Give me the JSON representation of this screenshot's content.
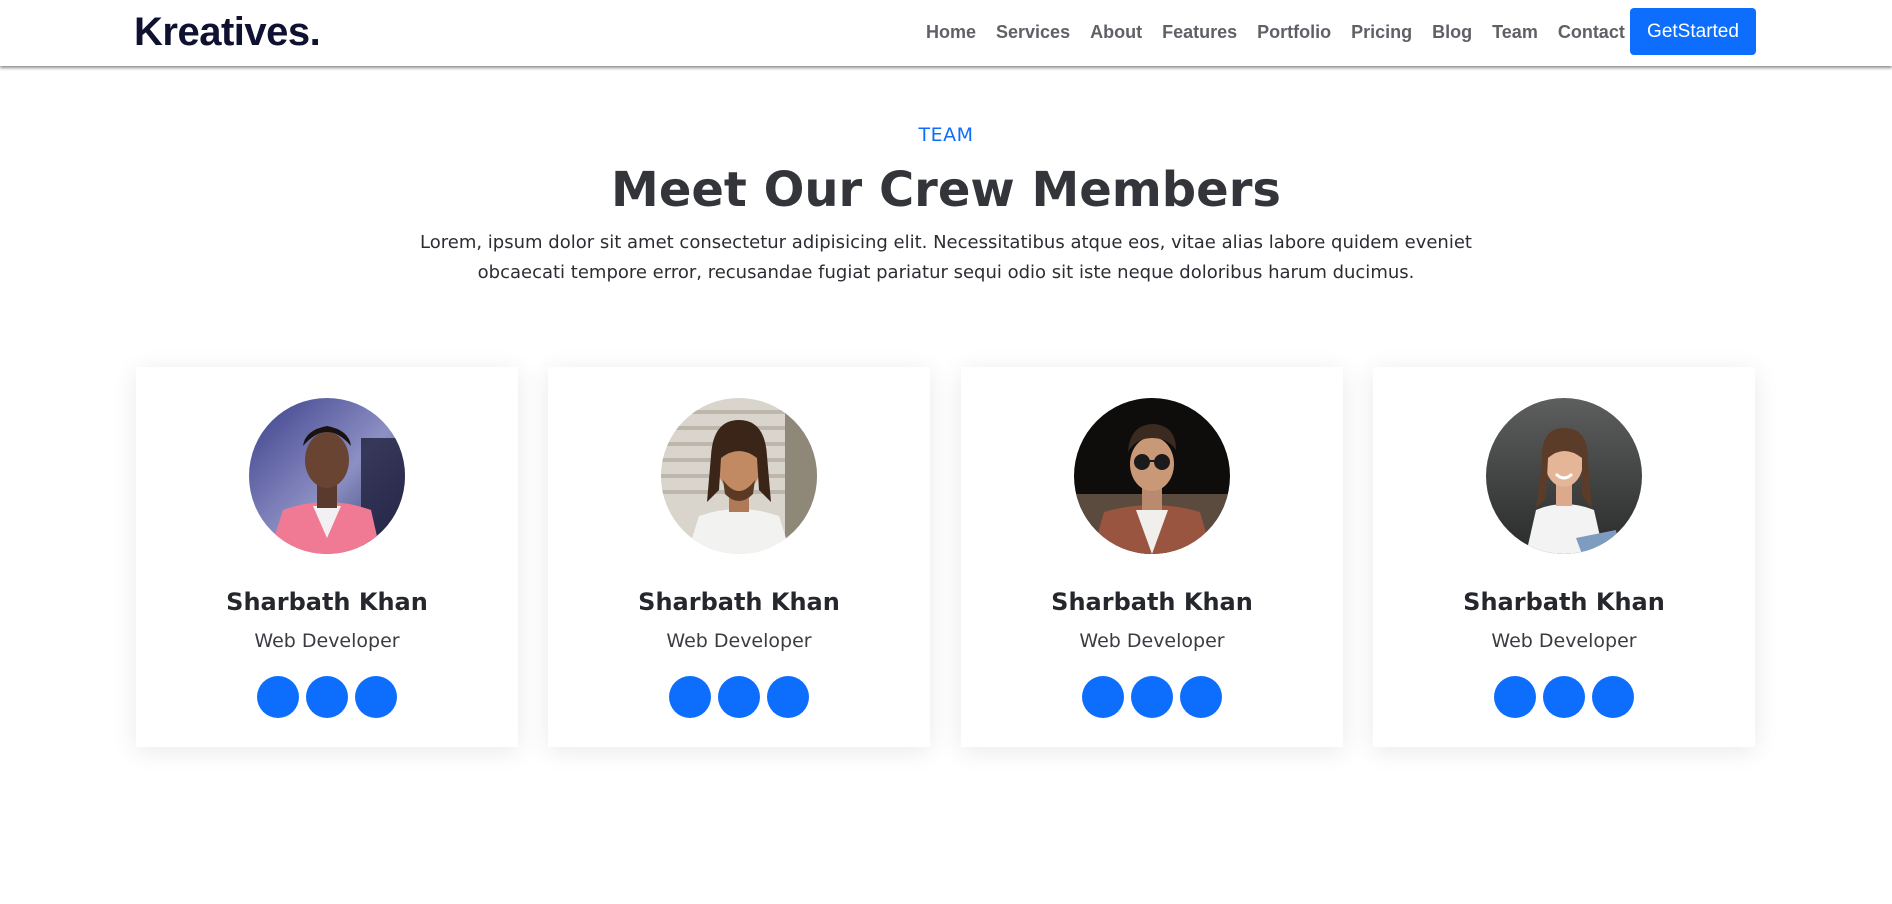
{
  "brand": {
    "logo": "Kreatives."
  },
  "nav": {
    "links": [
      "Home",
      "Services",
      "About",
      "Features",
      "Portfolio",
      "Pricing",
      "Blog",
      "Team",
      "Contact"
    ],
    "cta": "GetStarted"
  },
  "section": {
    "eyebrow": "TEAM",
    "title": "Meet Our Crew Members",
    "description": "Lorem, ipsum dolor sit amet consectetur adipisicing elit. Necessitatibus atque eos, vitae alias labore quidem eveniet obcaecati tempore error, recusandae fugiat pariatur sequi odio sit iste neque doloribus harum ducimus."
  },
  "team": [
    {
      "name": "Sharbath Khan",
      "role": "Web Developer",
      "socials": 3
    },
    {
      "name": "Sharbath Khan",
      "role": "Web Developer",
      "socials": 3
    },
    {
      "name": "Sharbath Khan",
      "role": "Web Developer",
      "socials": 3
    },
    {
      "name": "Sharbath Khan",
      "role": "Web Developer",
      "socials": 3
    }
  ],
  "colors": {
    "accent": "#0d6efd",
    "logo": "#0e1130",
    "nav_text": "#5f6166",
    "heading": "#33353a"
  }
}
